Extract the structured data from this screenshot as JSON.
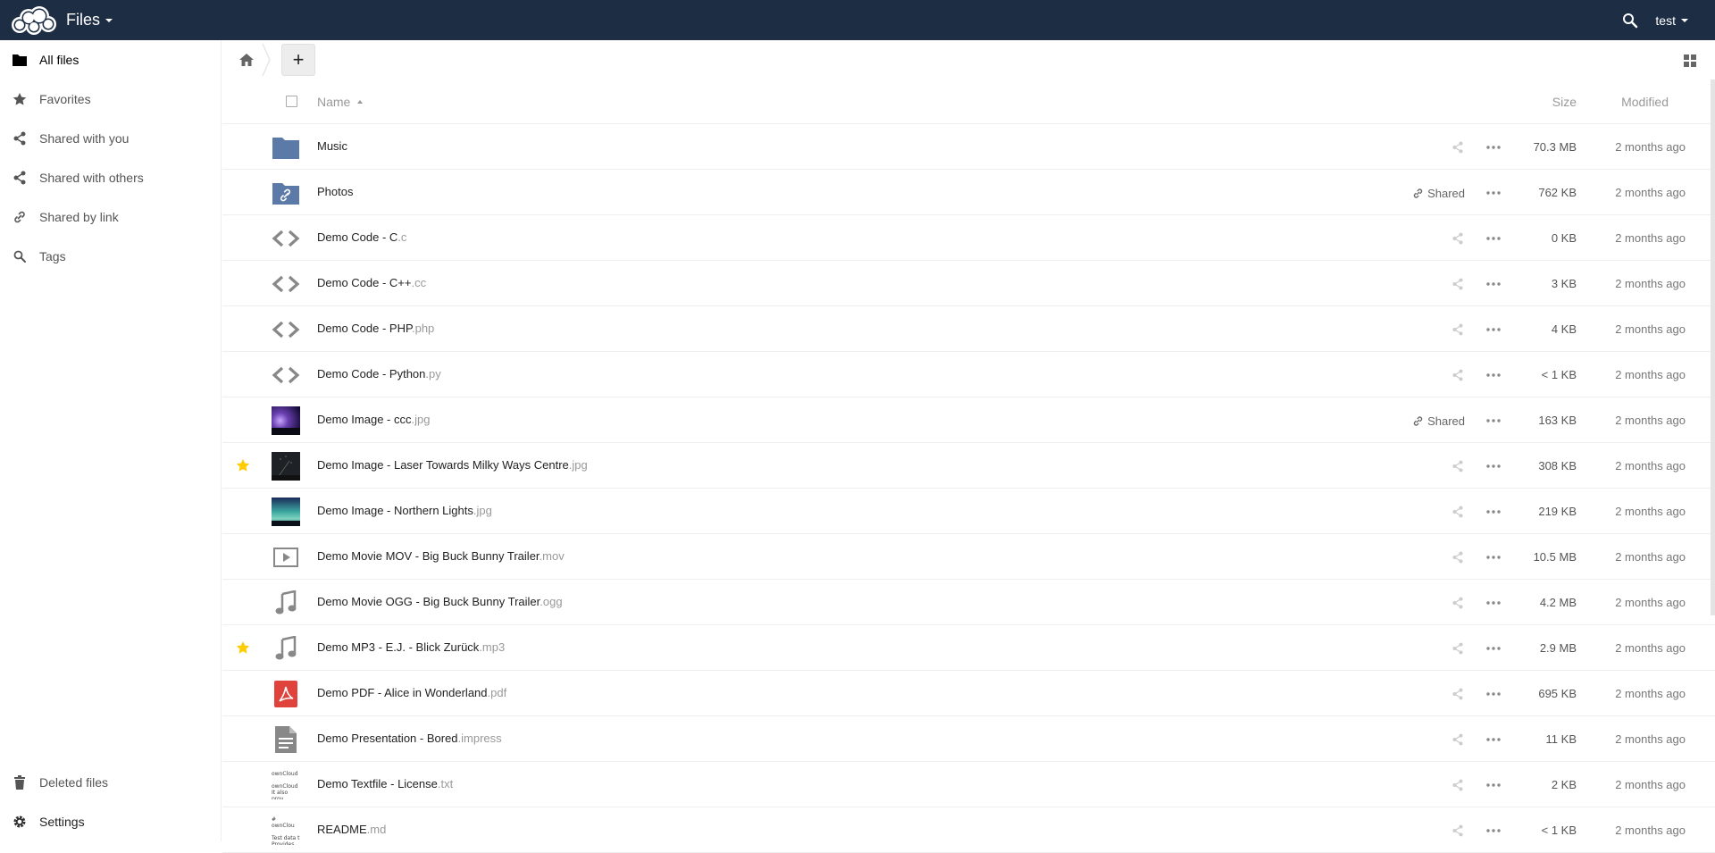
{
  "topbar": {
    "app_title": "Files",
    "user": "test"
  },
  "sidebar": {
    "items": [
      {
        "label": "All files",
        "icon": "folder-icon"
      },
      {
        "label": "Favorites",
        "icon": "star-icon"
      },
      {
        "label": "Shared with you",
        "icon": "share-icon"
      },
      {
        "label": "Shared with others",
        "icon": "share-icon"
      },
      {
        "label": "Shared by link",
        "icon": "link-icon"
      },
      {
        "label": "Tags",
        "icon": "search-icon"
      }
    ],
    "bottom": [
      {
        "label": "Deleted files",
        "icon": "trash-icon"
      },
      {
        "label": "Settings",
        "icon": "gear-icon"
      }
    ]
  },
  "controls": {
    "new_label": "+"
  },
  "table": {
    "headers": {
      "name": "Name",
      "size": "Size",
      "modified": "Modified"
    },
    "rows": [
      {
        "name": "Music",
        "ext": "",
        "type": "folder",
        "size": "70.3 MB",
        "modified": "2 months ago",
        "shared": false,
        "favorite": false
      },
      {
        "name": "Photos",
        "ext": "",
        "type": "folder-link",
        "size": "762 KB",
        "modified": "2 months ago",
        "shared": true,
        "share_label": "Shared",
        "favorite": false
      },
      {
        "name": "Demo Code - C",
        "ext": ".c",
        "type": "code",
        "size": "0 KB",
        "modified": "2 months ago",
        "shared": false,
        "favorite": false
      },
      {
        "name": "Demo Code - C++",
        "ext": ".cc",
        "type": "code",
        "size": "3 KB",
        "modified": "2 months ago",
        "shared": false,
        "favorite": false
      },
      {
        "name": "Demo Code - PHP",
        "ext": ".php",
        "type": "code",
        "size": "4 KB",
        "modified": "2 months ago",
        "shared": false,
        "favorite": false
      },
      {
        "name": "Demo Code - Python",
        "ext": ".py",
        "type": "code",
        "size": "< 1 KB",
        "modified": "2 months ago",
        "shared": false,
        "favorite": false
      },
      {
        "name": "Demo Image - ccc",
        "ext": ".jpg",
        "type": "image-purple",
        "size": "163 KB",
        "modified": "2 months ago",
        "shared": true,
        "share_label": "Shared",
        "favorite": false
      },
      {
        "name": "Demo Image - Laser Towards Milky Ways Centre",
        "ext": ".jpg",
        "type": "image-dark",
        "size": "308 KB",
        "modified": "2 months ago",
        "shared": false,
        "favorite": true
      },
      {
        "name": "Demo Image - Northern Lights",
        "ext": ".jpg",
        "type": "image-aurora",
        "size": "219 KB",
        "modified": "2 months ago",
        "shared": false,
        "favorite": false
      },
      {
        "name": "Demo Movie MOV - Big Buck Bunny Trailer",
        "ext": ".mov",
        "type": "video",
        "size": "10.5 MB",
        "modified": "2 months ago",
        "shared": false,
        "favorite": false
      },
      {
        "name": "Demo Movie OGG - Big Buck Bunny Trailer",
        "ext": ".ogg",
        "type": "audio",
        "size": "4.2 MB",
        "modified": "2 months ago",
        "shared": false,
        "favorite": false
      },
      {
        "name": "Demo MP3 - E.J. - Blick Zurück",
        "ext": ".mp3",
        "type": "audio",
        "size": "2.9 MB",
        "modified": "2 months ago",
        "shared": false,
        "favorite": true
      },
      {
        "name": "Demo PDF - Alice in Wonderland",
        "ext": ".pdf",
        "type": "pdf",
        "size": "695 KB",
        "modified": "2 months ago",
        "shared": false,
        "favorite": false
      },
      {
        "name": "Demo Presentation - Bored",
        "ext": ".impress",
        "type": "document",
        "size": "11 KB",
        "modified": "2 months ago",
        "shared": false,
        "favorite": false
      },
      {
        "name": "Demo Textfile - License",
        "ext": ".txt",
        "type": "text-thumb",
        "thumb_text": [
          "ownCloud",
          "",
          "ownCloud",
          "It also prov",
          "installation"
        ],
        "size": "2 KB",
        "modified": "2 months ago",
        "shared": false,
        "favorite": false
      },
      {
        "name": "README",
        "ext": ".md",
        "type": "text-thumb",
        "thumb_text": [
          "# ownClou",
          "",
          "Test data t",
          "Provides te"
        ],
        "size": "< 1 KB",
        "modified": "2 months ago",
        "shared": false,
        "favorite": false
      }
    ]
  },
  "colors": {
    "topbar": "#1d2d44",
    "folder": "#5b7aa8",
    "favorite": "#fc0",
    "pdf": "#e0433b"
  }
}
